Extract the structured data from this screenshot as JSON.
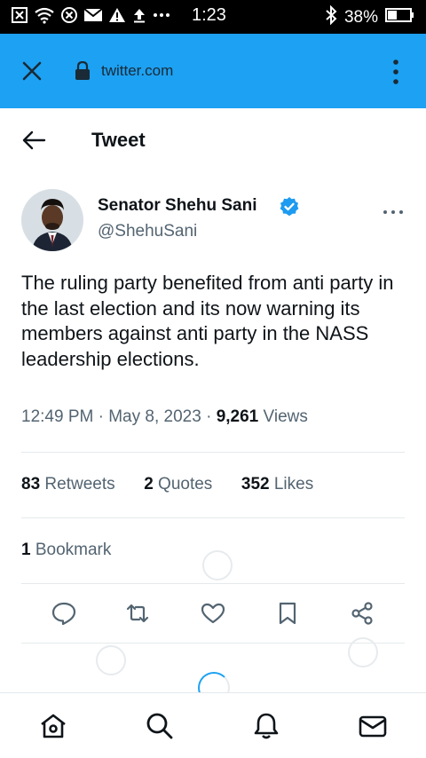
{
  "status_bar": {
    "time": "1:23",
    "battery": "38%"
  },
  "browser": {
    "url": "twitter.com"
  },
  "header": {
    "title": "Tweet"
  },
  "tweet": {
    "author_name": "Senator Shehu Sani",
    "author_handle": "@ShehuSani",
    "text": "The ruling party benefited from anti party in the last election and its now warning its members against anti party in the NASS leadership elections.",
    "time": "12:49 PM",
    "date": "May 8, 2023",
    "views_count": "9,261",
    "views_label": "Views",
    "separator": "·",
    "retweets_count": "83",
    "retweets_label": "Retweets",
    "quotes_count": "2",
    "quotes_label": "Quotes",
    "likes_count": "352",
    "likes_label": "Likes",
    "bookmarks_count": "1",
    "bookmarks_label": "Bookmark"
  },
  "colors": {
    "brand_blue": "#1da1f2",
    "verified_blue": "#1d9bf0",
    "text_primary": "#0f1419",
    "text_secondary": "#536471"
  },
  "icons": {
    "browser": [
      "close-icon",
      "lock-icon",
      "kebab-menu-icon"
    ],
    "actions": [
      "reply-icon",
      "retweet-icon",
      "like-icon",
      "bookmark-icon",
      "share-icon"
    ],
    "bottom_nav": [
      "home-icon",
      "search-icon",
      "notifications-icon",
      "messages-icon"
    ]
  }
}
